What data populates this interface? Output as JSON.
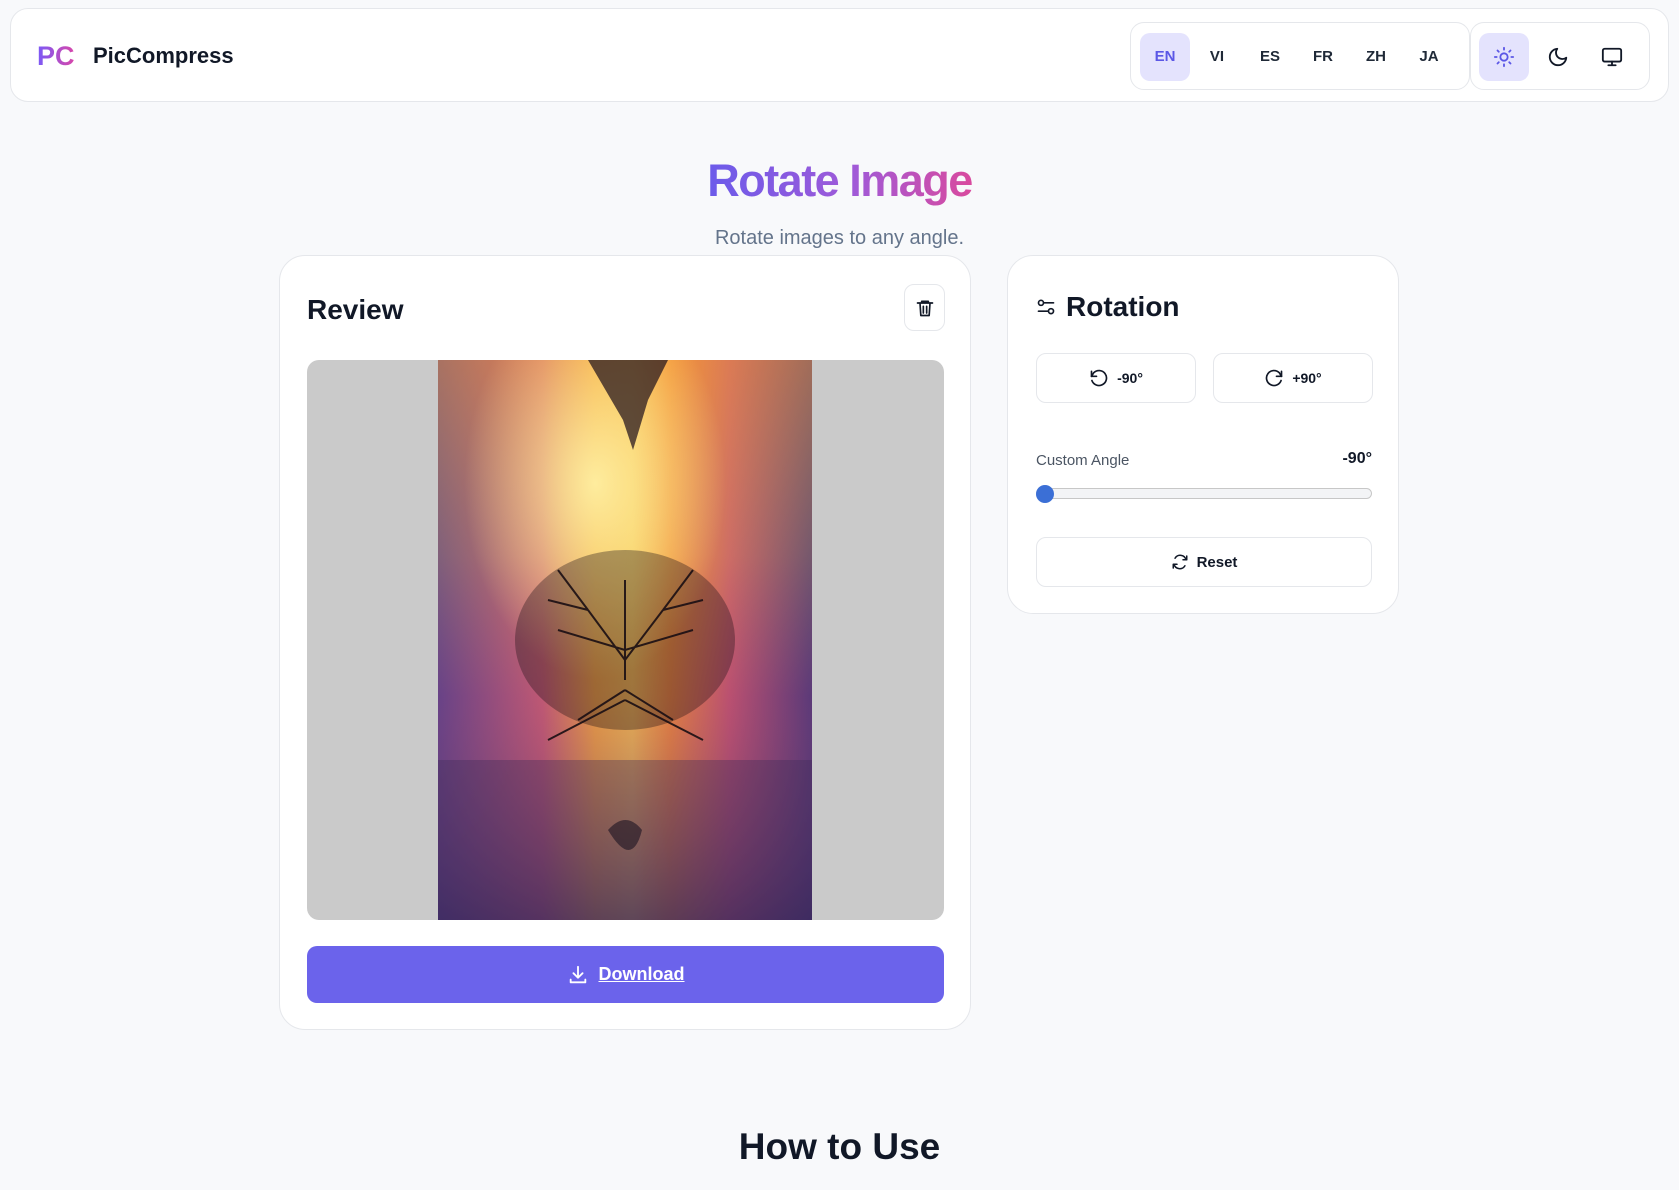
{
  "header": {
    "logo": "PC",
    "brand": "PicCompress",
    "languages": [
      "EN",
      "VI",
      "ES",
      "FR",
      "ZH",
      "JA"
    ],
    "active_language": "EN",
    "theme_modes": [
      "sun-icon",
      "moon-icon",
      "monitor-icon"
    ],
    "active_theme": "light"
  },
  "hero": {
    "title": "Rotate Image",
    "subtitle": "Rotate images to any angle."
  },
  "review": {
    "title": "Review",
    "download_label": "Download"
  },
  "rotation": {
    "title": "Rotation",
    "rotate_left_label": "-90°",
    "rotate_right_label": "+90°",
    "custom_angle_label": "Custom Angle",
    "custom_angle_value": "-90°",
    "slider_min": -90,
    "slider_max": 90,
    "slider_value": -90,
    "reset_label": "Reset"
  },
  "howto": {
    "title": "How to Use"
  },
  "colors": {
    "accent": "#6b63eb",
    "accent_light": "#e4e3fd",
    "slider_thumb": "#3b6fd6"
  }
}
